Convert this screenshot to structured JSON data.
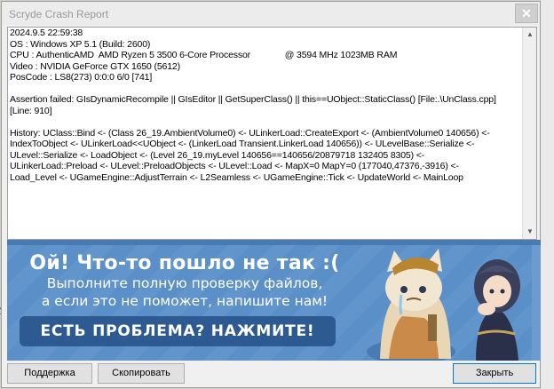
{
  "window": {
    "title": "Scryde Crash Report",
    "close_glyph": "✕"
  },
  "report": {
    "header_lines": [
      "2024.9.5 22:59:38",
      "OS : Windows XP 5.1 (Build: 2600)",
      "CPU : AuthenticAMD  AMD Ryzen 5 3500 6-Core Processor              @ 3594 MHz 1023MB RAM",
      "Video : NVIDIA GeForce GTX 1650 (5612)",
      "PosCode : LS8(273) 0:0:0 6/0 [741]"
    ],
    "assert_lines": [
      "Assertion failed: GIsDynamicRecompile || GIsEditor || GetSuperClass() || this==UObject::StaticClass() [File:.\\UnClass.cpp]",
      "[Line: 910]"
    ],
    "history_lines": [
      "History: UClass::Bind <- (Class 26_19.AmbientVolume0) <- ULinkerLoad::CreateExport <- (AmbientVolume0 140656) <-",
      "IndexToObject <- ULinkerLoad<<UObject <- (LinkerLoad Transient.LinkerLoad 140656)) <- ULevelBase::Serialize <-",
      "ULevel::Serialize <- LoadObject <- (Level 26_19.myLevel 140656==140656/20879718 132405 8305) <-",
      "ULinkerLoad::Preload <- ULevel::PreloadObjects <- ULevel::Load <- MapX=0 MapY=0 (177040,47376,-3916) <-",
      "Load_Level <- UGameEngine::AdjustTerrain <- L2Seamless <- UGameEngine::Tick <- UpdateWorld <- MainLoop"
    ]
  },
  "banner": {
    "headline": "Ой! Что-то пошло не так :(",
    "line1": "Выполните полную проверку файлов,",
    "line2": "а если это не поможет, напишите нам!",
    "cta": "ЕСТЬ ПРОБЛЕМА? НАЖМИТЕ!",
    "bg_color": "#5a8fc8",
    "cta_color": "#2d5a90"
  },
  "buttons": {
    "support": "Поддержка",
    "copy": "Скопировать",
    "close": "Закрыть"
  },
  "background": {
    "fragment_text": "y"
  }
}
